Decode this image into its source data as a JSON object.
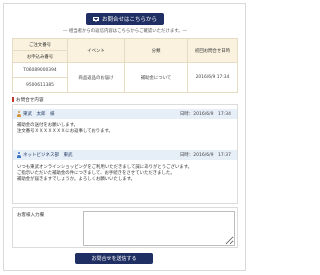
{
  "header": {
    "inquiry_button": "お問合せはこちらから",
    "note": "― 相当者からの返信内容はこちらからご確認いただけます。―"
  },
  "summary": {
    "headers": {
      "col1_top": "ご注文番号",
      "col1_bottom": "お申込み番号",
      "event": "イベント",
      "category": "分類",
      "initial_date": "初回お問合せ日時"
    },
    "row": {
      "order_no": "T06089000394",
      "apply_no": "9500611385",
      "event": "商品返品のお届け",
      "category": "補助金について",
      "initial_date": "2016/6/9 17:34"
    }
  },
  "history": {
    "section_title": "お問合せ内容",
    "messages": [
      {
        "author": "東武　太郎　様",
        "datetime": "日時：2016/6/9　17:34",
        "line1": "補助金の送付をお願いします。",
        "line2": "注文番号ＸＸＸＸＸＸＸにお返事しております。"
      },
      {
        "author": "ネットビジネス部　東武",
        "datetime": "日時：2016/6/9　17:37",
        "line1": "いつも東武オンラインショッピングをご利用いただきまして誠にありがとうございます。",
        "line2": "ご指示いただいた補助金の件につきまして、お手続きをさせていただきました。",
        "line3": "補助金が届きますでしょうか。よろしくお願いいたします。"
      }
    ]
  },
  "input": {
    "label": "お客様入力欄",
    "value": ""
  },
  "submit_button": "お問合せを送信する"
}
